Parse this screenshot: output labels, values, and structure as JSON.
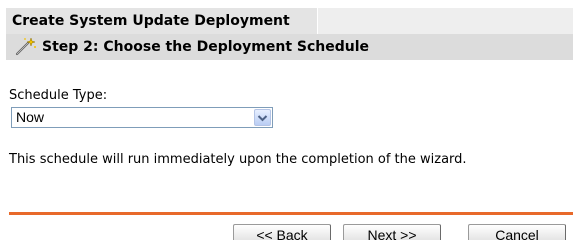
{
  "header": {
    "title": "Create System Update Deployment",
    "step_label": "Step 2: Choose the Deployment Schedule",
    "step_icon": "magic-wand-icon"
  },
  "schedule": {
    "label": "Schedule Type:",
    "selected": "Now",
    "description": "This schedule will run immediately upon the completion of the wizard."
  },
  "buttons": {
    "back": "<< Back",
    "next": "Next >>",
    "cancel": "Cancel"
  },
  "colors": {
    "divider": "#e8692a",
    "header_bg": "#e4e4e4",
    "step_bg": "#dcdcdc"
  }
}
